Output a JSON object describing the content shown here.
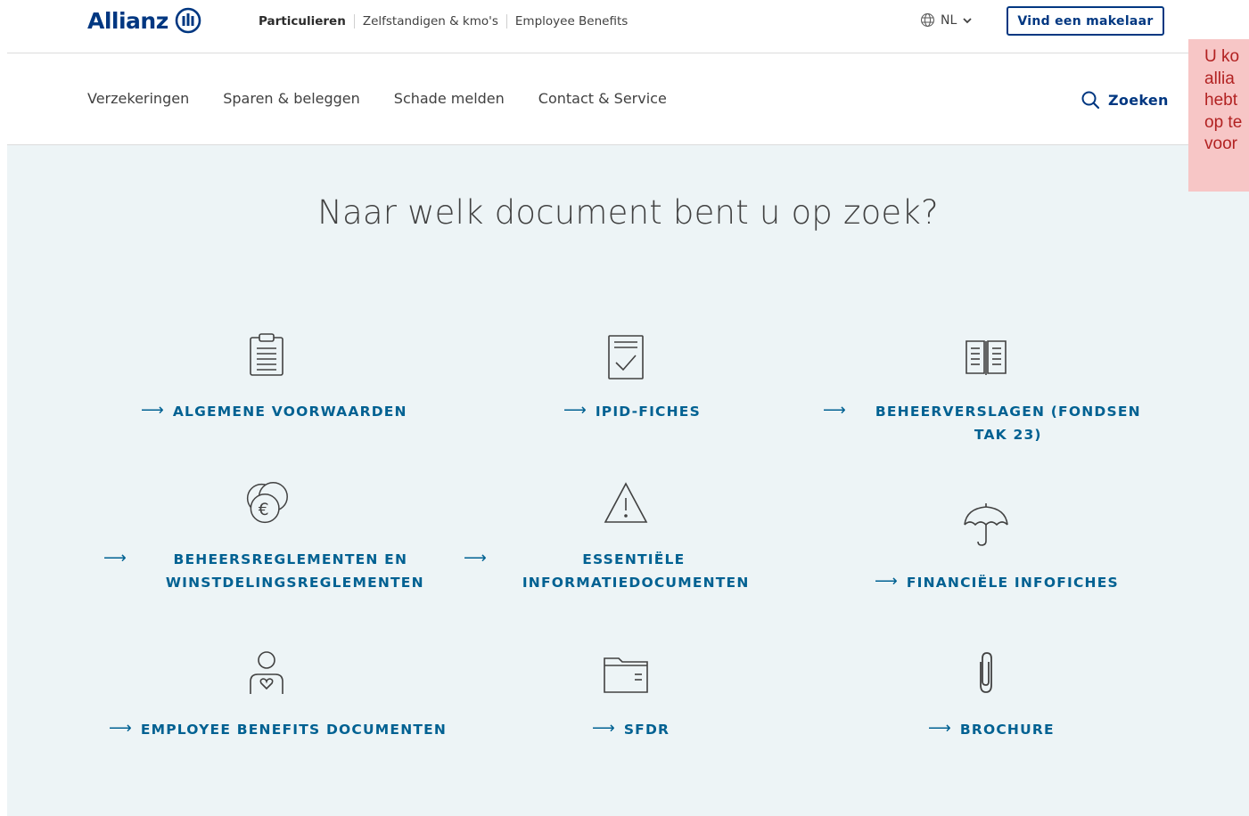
{
  "brand": {
    "name": "Allianz",
    "color": "#003781",
    "link_color": "#006192",
    "content_bg": "#edf4f6"
  },
  "topbar": {
    "segments": [
      {
        "label": "Particulieren",
        "active": true
      },
      {
        "label": "Zelfstandigen & kmo's",
        "active": false
      },
      {
        "label": "Employee Benefits",
        "active": false
      }
    ],
    "language": {
      "icon": "globe-icon",
      "value": "NL"
    },
    "broker_button": "Vind een makelaar"
  },
  "nav": {
    "items": [
      "Verzekeringen",
      "Sparen & beleggen",
      "Schade melden",
      "Contact & Service"
    ],
    "search_label": "Zoeken"
  },
  "main": {
    "heading": "Naar welk document bent u op zoek?",
    "tiles": [
      {
        "icon": "clipboard-icon",
        "label": "ALGEMENE VOORWAARDEN"
      },
      {
        "icon": "checked-document-icon",
        "label": "IPID-FICHES"
      },
      {
        "icon": "open-book-icon",
        "label": "BEHEERVERSLAGEN (FONDSEN TAK 23)"
      },
      {
        "icon": "euro-coins-icon",
        "label": "BEHEERSREGLEMENTEN EN WINSTDELINGSREGLEMENTEN"
      },
      {
        "icon": "warning-triangle-icon",
        "label": "ESSENTIËLE INFORMATIEDOCUMENTEN"
      },
      {
        "icon": "umbrella-icon",
        "label": "FINANCIËLE INFOFICHES"
      },
      {
        "icon": "person-heart-icon",
        "label": "EMPLOYEE BENEFITS DOCUMENTEN"
      },
      {
        "icon": "folder-icon",
        "label": "SFDR"
      },
      {
        "icon": "paperclip-icon",
        "label": "BROCHURE"
      }
    ]
  },
  "notice": {
    "lines": [
      "U ko",
      "allia",
      "hebt",
      "op te",
      "voor"
    ],
    "color": "#f7c6c6"
  }
}
